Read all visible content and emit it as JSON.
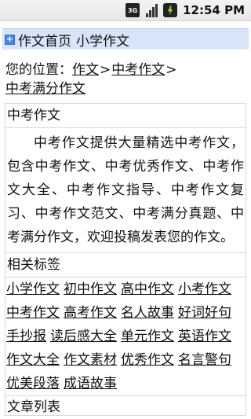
{
  "status_bar": {
    "network_icon": "3g-icon",
    "network_text": "3G",
    "signal_icon": "signal-icon",
    "battery_icon": "battery-charging-icon",
    "time": "12:54 PM"
  },
  "header": {
    "icon": "plus-box-icon",
    "home_link": "作文首页",
    "section": "小学作文"
  },
  "breadcrumb": {
    "prefix": "您的位置：",
    "items": [
      "作文",
      "中考作文"
    ],
    "separator": ">",
    "current": "中考满分作文"
  },
  "intro_box": {
    "title": "中考作文",
    "body": "中考作文提供大量精选中考作文，包含中考作文、中考优秀作文、中考作文大全、中考作文指导、中考作文复习、中考作文范文、中考满分真题、中考满分作文，欢迎投稿发表您的作文。"
  },
  "tags_box": {
    "title": "相关标签",
    "tags": [
      "小学作文",
      "初中作文",
      "高中作文",
      "小考作文",
      "中考作文",
      "高考作文",
      "名人故事",
      "好词好句",
      "手抄报",
      "读后感大全",
      "单元作文",
      "英语作文",
      "作文大全",
      "作文素材",
      "优秀作文",
      "名言警句",
      "优美段落",
      "成语故事"
    ]
  },
  "list_box": {
    "title": "文章列表"
  },
  "colors": {
    "header_bg": "#d8e4f7",
    "icon_blue": "#4a86de",
    "border": "#d8d8d8"
  }
}
